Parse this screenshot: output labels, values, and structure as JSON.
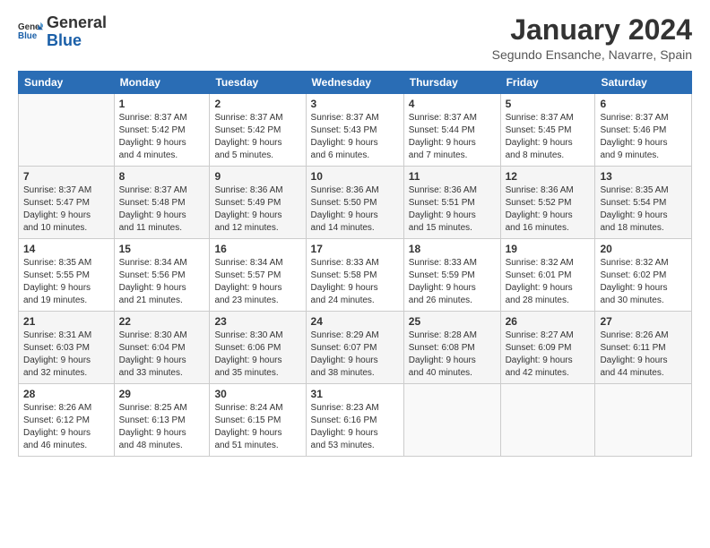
{
  "logo": {
    "text_general": "General",
    "text_blue": "Blue"
  },
  "header": {
    "month_title": "January 2024",
    "subtitle": "Segundo Ensanche, Navarre, Spain"
  },
  "days_of_week": [
    "Sunday",
    "Monday",
    "Tuesday",
    "Wednesday",
    "Thursday",
    "Friday",
    "Saturday"
  ],
  "weeks": [
    [
      {
        "day": "",
        "sunrise": "",
        "sunset": "",
        "daylight": "",
        "minutes": ""
      },
      {
        "day": "1",
        "sunrise": "8:37 AM",
        "sunset": "5:42 PM",
        "hours": "9",
        "minutes": "4"
      },
      {
        "day": "2",
        "sunrise": "8:37 AM",
        "sunset": "5:42 PM",
        "hours": "9",
        "minutes": "5"
      },
      {
        "day": "3",
        "sunrise": "8:37 AM",
        "sunset": "5:43 PM",
        "hours": "9",
        "minutes": "6"
      },
      {
        "day": "4",
        "sunrise": "8:37 AM",
        "sunset": "5:44 PM",
        "hours": "9",
        "minutes": "7"
      },
      {
        "day": "5",
        "sunrise": "8:37 AM",
        "sunset": "5:45 PM",
        "hours": "9",
        "minutes": "8"
      },
      {
        "day": "6",
        "sunrise": "8:37 AM",
        "sunset": "5:46 PM",
        "hours": "9",
        "minutes": "9"
      }
    ],
    [
      {
        "day": "7",
        "sunrise": "8:37 AM",
        "sunset": "5:47 PM",
        "hours": "9",
        "minutes": "10"
      },
      {
        "day": "8",
        "sunrise": "8:37 AM",
        "sunset": "5:48 PM",
        "hours": "9",
        "minutes": "11"
      },
      {
        "day": "9",
        "sunrise": "8:36 AM",
        "sunset": "5:49 PM",
        "hours": "9",
        "minutes": "12"
      },
      {
        "day": "10",
        "sunrise": "8:36 AM",
        "sunset": "5:50 PM",
        "hours": "9",
        "minutes": "14"
      },
      {
        "day": "11",
        "sunrise": "8:36 AM",
        "sunset": "5:51 PM",
        "hours": "9",
        "minutes": "15"
      },
      {
        "day": "12",
        "sunrise": "8:36 AM",
        "sunset": "5:52 PM",
        "hours": "9",
        "minutes": "16"
      },
      {
        "day": "13",
        "sunrise": "8:35 AM",
        "sunset": "5:54 PM",
        "hours": "9",
        "minutes": "18"
      }
    ],
    [
      {
        "day": "14",
        "sunrise": "8:35 AM",
        "sunset": "5:55 PM",
        "hours": "9",
        "minutes": "19"
      },
      {
        "day": "15",
        "sunrise": "8:34 AM",
        "sunset": "5:56 PM",
        "hours": "9",
        "minutes": "21"
      },
      {
        "day": "16",
        "sunrise": "8:34 AM",
        "sunset": "5:57 PM",
        "hours": "9",
        "minutes": "23"
      },
      {
        "day": "17",
        "sunrise": "8:33 AM",
        "sunset": "5:58 PM",
        "hours": "9",
        "minutes": "24"
      },
      {
        "day": "18",
        "sunrise": "8:33 AM",
        "sunset": "5:59 PM",
        "hours": "9",
        "minutes": "26"
      },
      {
        "day": "19",
        "sunrise": "8:32 AM",
        "sunset": "6:01 PM",
        "hours": "9",
        "minutes": "28"
      },
      {
        "day": "20",
        "sunrise": "8:32 AM",
        "sunset": "6:02 PM",
        "hours": "9",
        "minutes": "30"
      }
    ],
    [
      {
        "day": "21",
        "sunrise": "8:31 AM",
        "sunset": "6:03 PM",
        "hours": "9",
        "minutes": "32"
      },
      {
        "day": "22",
        "sunrise": "8:30 AM",
        "sunset": "6:04 PM",
        "hours": "9",
        "minutes": "33"
      },
      {
        "day": "23",
        "sunrise": "8:30 AM",
        "sunset": "6:06 PM",
        "hours": "9",
        "minutes": "35"
      },
      {
        "day": "24",
        "sunrise": "8:29 AM",
        "sunset": "6:07 PM",
        "hours": "9",
        "minutes": "38"
      },
      {
        "day": "25",
        "sunrise": "8:28 AM",
        "sunset": "6:08 PM",
        "hours": "9",
        "minutes": "40"
      },
      {
        "day": "26",
        "sunrise": "8:27 AM",
        "sunset": "6:09 PM",
        "hours": "9",
        "minutes": "42"
      },
      {
        "day": "27",
        "sunrise": "8:26 AM",
        "sunset": "6:11 PM",
        "hours": "9",
        "minutes": "44"
      }
    ],
    [
      {
        "day": "28",
        "sunrise": "8:26 AM",
        "sunset": "6:12 PM",
        "hours": "9",
        "minutes": "46"
      },
      {
        "day": "29",
        "sunrise": "8:25 AM",
        "sunset": "6:13 PM",
        "hours": "9",
        "minutes": "48"
      },
      {
        "day": "30",
        "sunrise": "8:24 AM",
        "sunset": "6:15 PM",
        "hours": "9",
        "minutes": "51"
      },
      {
        "day": "31",
        "sunrise": "8:23 AM",
        "sunset": "6:16 PM",
        "hours": "9",
        "minutes": "53"
      },
      {
        "day": "",
        "sunrise": "",
        "sunset": "",
        "hours": "",
        "minutes": ""
      },
      {
        "day": "",
        "sunrise": "",
        "sunset": "",
        "hours": "",
        "minutes": ""
      },
      {
        "day": "",
        "sunrise": "",
        "sunset": "",
        "hours": "",
        "minutes": ""
      }
    ]
  ]
}
